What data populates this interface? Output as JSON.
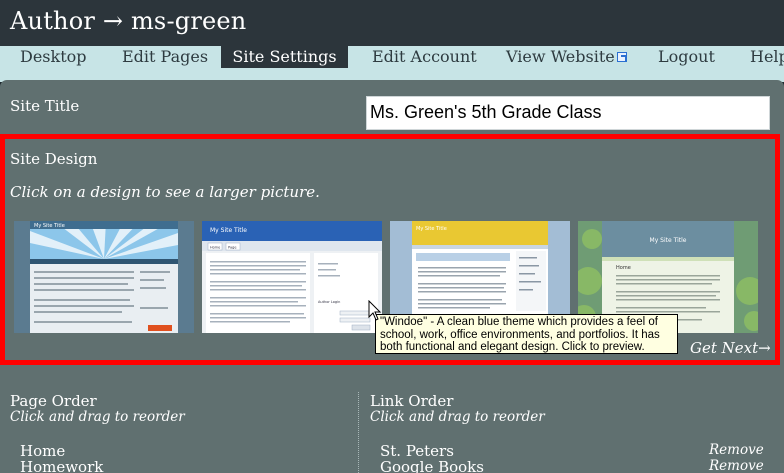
{
  "header": {
    "title": "Author → ms-green"
  },
  "nav": {
    "tabs": [
      {
        "label": "Desktop"
      },
      {
        "label": "Edit Pages"
      },
      {
        "label": "Site Settings",
        "active": true
      },
      {
        "label": "Edit Account"
      },
      {
        "label": "View Website"
      },
      {
        "label": "Logout"
      },
      {
        "label": "Help"
      }
    ]
  },
  "site_title": {
    "label": "Site Title",
    "value": "Ms. Green's 5th Grade Class"
  },
  "site_design": {
    "label": "Site Design",
    "hint": "Click on a design to see a larger picture.",
    "get_next": "Get Next→",
    "tooltip": "\"Windoe\" - A clean blue theme which provides a feel of school, work, office environments, and portfolios. It has both functional and elegant design. Click to preview.",
    "thumbnails": [
      {
        "title": "My Site Title"
      },
      {
        "title": "My Site Title",
        "nav": [
          "Home",
          "Page"
        ],
        "sidebar_heading": "Author Login"
      },
      {
        "title": "My Site Title"
      },
      {
        "title": "My Site Title",
        "nav": [
          "Home"
        ]
      }
    ]
  },
  "page_order": {
    "title": "Page Order",
    "subtitle": "Click and drag to reorder",
    "items": [
      "Home",
      "Homework"
    ]
  },
  "link_order": {
    "title": "Link Order",
    "subtitle": "Click and drag to reorder",
    "remove_label": "Remove",
    "items": [
      "St. Peters",
      "Google Books"
    ]
  },
  "colors": {
    "header_bg": "#2c353b",
    "nav_bg": "#c7e4e6",
    "panel_bg": "#607070",
    "highlight_border": "#ff0000",
    "tooltip_bg": "#ffffe1"
  }
}
